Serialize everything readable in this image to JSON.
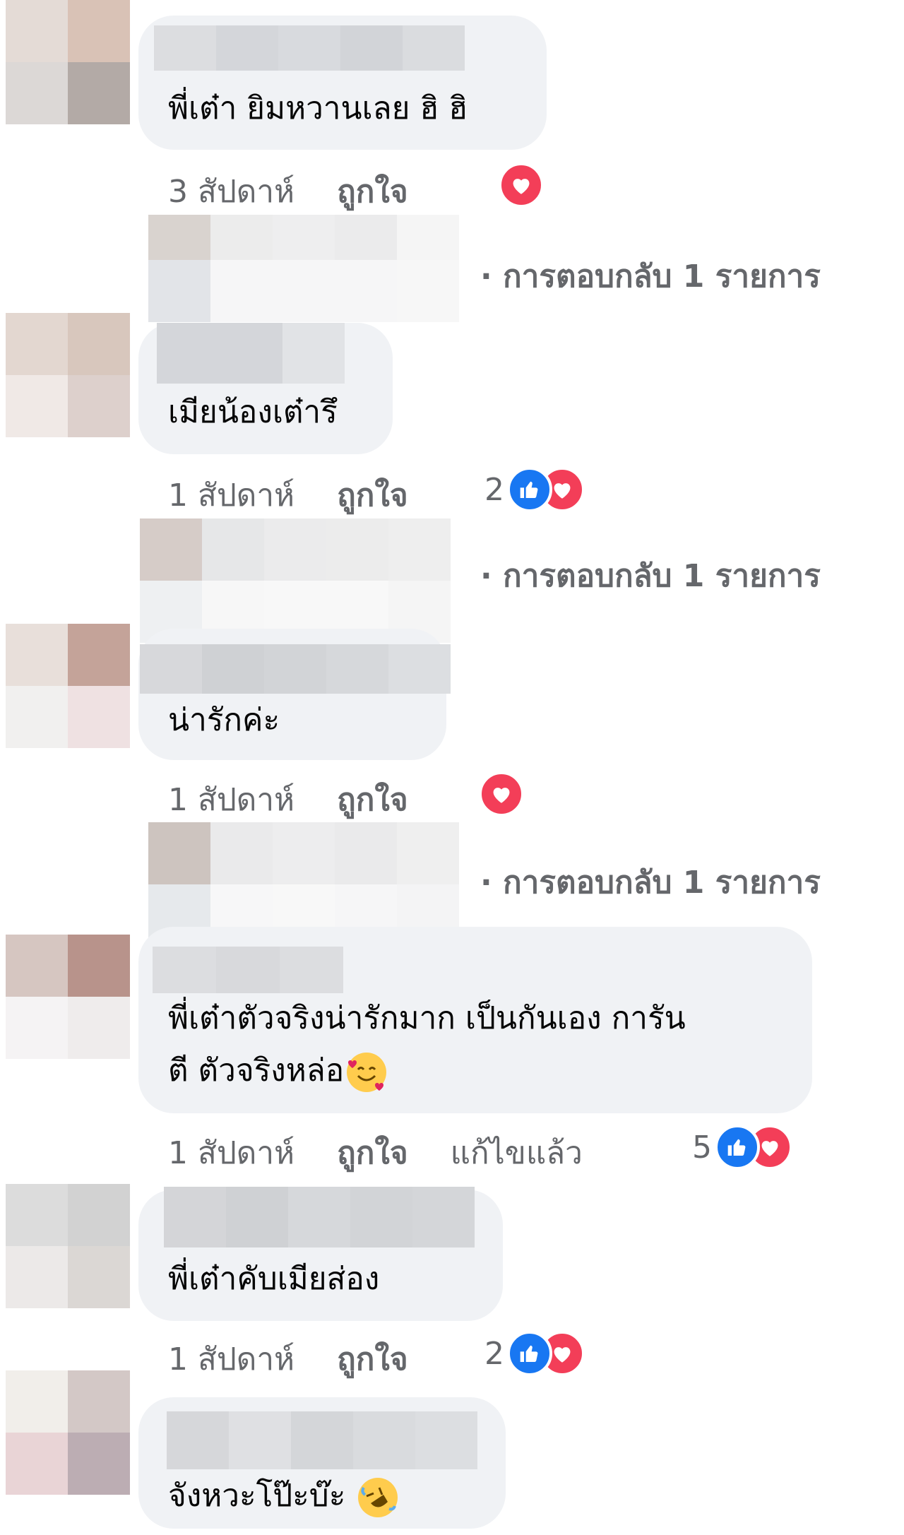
{
  "comments": [
    {
      "text": "พี่เต๋า ยิมหวานเลย ฮิ ฮิ",
      "time": "3 สัปดาห์",
      "like": "ถูกใจ",
      "reaction_count": "",
      "reactions": [
        "love"
      ],
      "reply_link": "· การตอบกลับ 1 รายการ"
    },
    {
      "text": "เมียน้องเต๋ารึ",
      "time": "1 สัปดาห์",
      "like": "ถูกใจ",
      "reaction_count": "2",
      "reactions": [
        "like",
        "love"
      ],
      "reply_link": "· การตอบกลับ 1 รายการ"
    },
    {
      "text": "น่ารักค่ะ",
      "time": "1 สัปดาห์",
      "like": "ถูกใจ",
      "reaction_count": "",
      "reactions": [
        "love"
      ],
      "reply_link": "· การตอบกลับ 1 รายการ"
    },
    {
      "text_line1": "พี่เต๋าตัวจริงน่ารักมาก เป็นกันเอง การัน",
      "text_line2": "ตี ตัวจริงหล่อ",
      "emoji": "smiling-face-with-hearts",
      "time": "1 สัปดาห์",
      "like": "ถูกใจ",
      "edited": "แก้ไขแล้ว",
      "reaction_count": "5",
      "reactions": [
        "like",
        "love"
      ]
    },
    {
      "text": "พี่เต๋าคับเมียส่อง",
      "time": "1 สัปดาห์",
      "like": "ถูกใจ",
      "reaction_count": "2",
      "reactions": [
        "like",
        "love"
      ]
    },
    {
      "text": "จังหวะโป๊ะบ๊ะ",
      "emoji": "rolling-on-floor-laughing"
    }
  ],
  "colors": {
    "bubble": "#f0f2f5",
    "meta_text": "#65676b",
    "like_blue": "#1877f2",
    "love_red": "#f33e58"
  }
}
